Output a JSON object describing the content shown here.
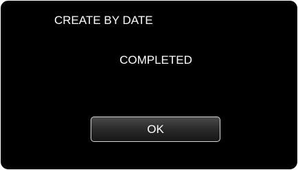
{
  "dialog": {
    "title": "CREATE BY DATE",
    "message": "COMPLETED",
    "ok_label": "OK"
  },
  "colors": {
    "background": "#000000",
    "text": "#ffffff",
    "button_border": "#d8d8d8"
  }
}
